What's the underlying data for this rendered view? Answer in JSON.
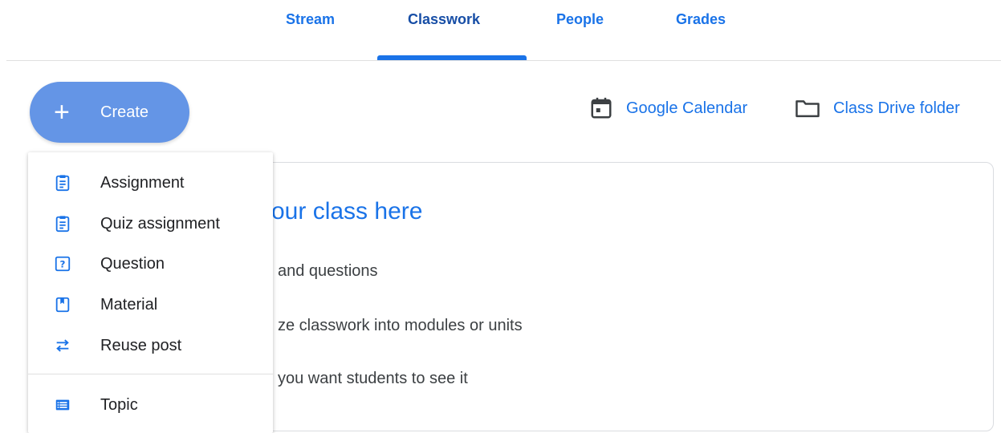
{
  "tabs": [
    {
      "label": "Stream",
      "active": false
    },
    {
      "label": "Classwork",
      "active": true
    },
    {
      "label": "People",
      "active": false
    },
    {
      "label": "Grades",
      "active": false
    }
  ],
  "create": {
    "label": "Create",
    "icon": "plus-icon"
  },
  "links": {
    "calendar": {
      "label": "Google Calendar",
      "icon": "calendar-icon"
    },
    "drive": {
      "label": "Class Drive folder",
      "icon": "folder-icon"
    }
  },
  "card": {
    "title": "our class here",
    "lines": [
      "and questions",
      "ze classwork into modules or units",
      "you want students to see it"
    ]
  },
  "menu": {
    "items": [
      {
        "label": "Assignment",
        "icon": "assignment-icon"
      },
      {
        "label": "Quiz assignment",
        "icon": "quiz-assignment-icon"
      },
      {
        "label": "Question",
        "icon": "question-icon"
      },
      {
        "label": "Material",
        "icon": "material-icon"
      },
      {
        "label": "Reuse post",
        "icon": "reuse-icon"
      },
      {
        "label": "Topic",
        "icon": "topic-icon"
      }
    ]
  },
  "colors": {
    "accent": "#1a73e8",
    "create_bg": "#6495e6",
    "icon": "#1a73e8",
    "text": "#202124"
  }
}
